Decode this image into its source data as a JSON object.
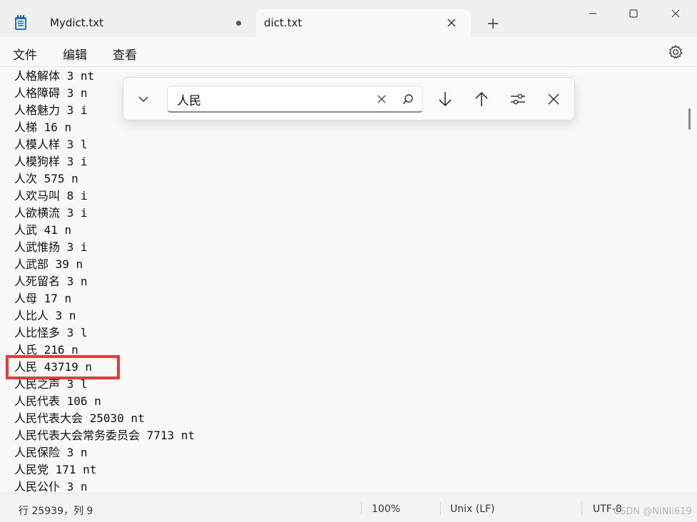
{
  "tabs": [
    {
      "label": "Mydict.txt",
      "state": "unsaved"
    },
    {
      "label": "dict.txt",
      "state": "active"
    }
  ],
  "window_controls": {
    "minimize": "—",
    "maximize": "☐",
    "close": "✕"
  },
  "new_tab": "+",
  "menu": {
    "file": "文件",
    "edit": "编辑",
    "view": "查看"
  },
  "editor": {
    "lines": [
      "人格解体 3 nt",
      "人格障碍 3 n",
      "人格魅力 3 i",
      "人梯 16 n",
      "人模人样 3 l",
      "人模狗样 3 i",
      "人次 575 n",
      "人欢马叫 8 i",
      "人欲横流 3 i",
      "人武 41 n",
      "人武惟扬 3 i",
      "人武部 39 n",
      "人死留名 3 n",
      "人母 17 n",
      "人比人 3 n",
      "人比怪多 3 l",
      "人氏 216 n",
      "人民 43719 n",
      "人民之声 3 l",
      "人民代表 106 n",
      "人民代表大会 25030 nt",
      "人民代表大会常务委员会 7713 nt",
      "人民保险 3 n",
      "人民党 171 nt",
      "人民公仆 3 n"
    ],
    "highlighted_line": "人民 43719 n"
  },
  "find": {
    "query": "人民",
    "icons": [
      "chevron-down-icon",
      "clear-icon",
      "search-icon",
      "arrow-down-icon",
      "arrow-up-icon",
      "options-icon",
      "close-icon"
    ]
  },
  "status": {
    "position": "行 25939，列 9",
    "zoom": "100%",
    "line_ending": "Unix (LF)",
    "encoding": "UTF-8"
  },
  "watermark": "CSDN @NINIi619",
  "colors": {
    "highlight_border": "#e83a3a",
    "notepad_blue": "#2b74c8"
  }
}
